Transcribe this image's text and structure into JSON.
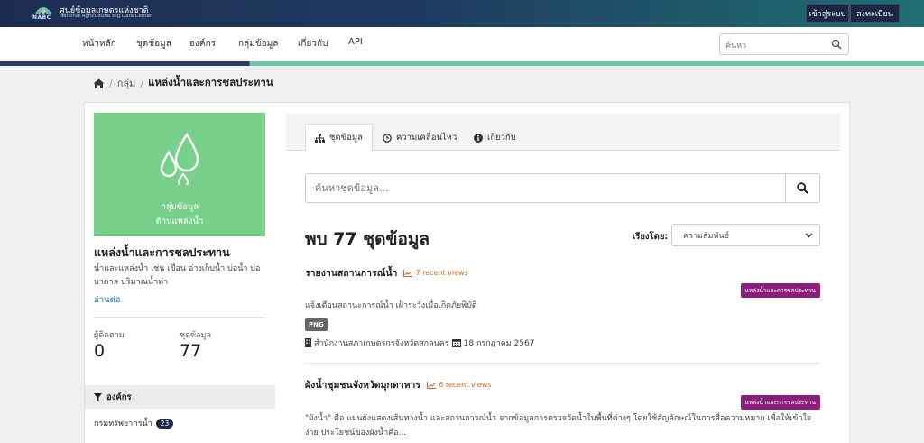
{
  "header": {
    "logo_text": "NABC",
    "site_title": "ศูนย์ข้อมูลเกษตรแห่งชาติ",
    "site_subtitle": "National Agricultural Big Data Center",
    "login_label": "เข้าสู่ระบบ",
    "register_label": "ลงทะเบียน"
  },
  "nav": {
    "items": [
      "หน้าหลัก",
      "ชุดข้อมูล",
      "องค์กร",
      "กลุ่มข้อมูล",
      "เกี่ยวกับ",
      "API"
    ],
    "search_placeholder": "ค้นหา"
  },
  "breadcrumb": {
    "home_icon": "home-icon",
    "level1": "กลุ่ม",
    "current": "แหล่งน้ำและการชลประทาน"
  },
  "sidebar": {
    "image_text_line1": "กลุ่มข้อมูล",
    "image_text_line2": "ด้านแหล่งน้ำ",
    "group_name": "แหล่งน้ำและการชลประทาน",
    "group_description": "น้ำและแหล่งน้ำ เช่น เขื่อน อ่างเก็บน้ำ บ่อน้ำ บ่อบาดาล ปริมาณน้ำท่า",
    "read_more": "อ่านต่อ",
    "followers_label": "ผู้ติดตาม",
    "followers_value": "0",
    "datasets_label": "ชุดข้อมูล",
    "datasets_value": "77",
    "org_header": "องค์กร",
    "orgs": [
      {
        "name": "กรมทรัพยากรน้ำ",
        "count": "23"
      }
    ]
  },
  "tabs": [
    {
      "label": "ชุดข้อมูล",
      "icon": "sitemap-icon"
    },
    {
      "label": "ความเคลื่อนไหว",
      "icon": "clock-icon"
    },
    {
      "label": "เกี่ยวกับ",
      "icon": "info-icon"
    }
  ],
  "search": {
    "placeholder": "ค้นหาชุดข้อมูล..."
  },
  "results": {
    "count_text": "พบ 77 ชุดข้อมูล",
    "sort_label": "เรียงโดย:",
    "sort_value": "ความสัมพันธ์"
  },
  "datasets": [
    {
      "title": "รายงานสถานการณ์น้ำ",
      "views": "7 recent views",
      "tag": "แหล่งน้ำและการชลประทาน",
      "description": "แจ้งเตือนสถานะการณ์น้ำ เฝ้าระวังเมื่อเกิดภัยพิบัติ",
      "format": "PNG",
      "org": "สำนักงานสภาเกษตรกรจังหวัดสกลนคร",
      "date": "18 กรกฎาคม 2567"
    },
    {
      "title": "ผังน้ำชุมชนจังหวัดมุกดาหาร",
      "views": "6 recent views",
      "tag": "แหล่งน้ำและการชลประทาน",
      "description": "\"ผังน้ำ\" คือ แผนผังแสดงเส้นทางน้ำ และสถานการณ์น้ำ จากข้อมูลการตรวจวัดน้ำในพื้นที่ต่างๆ โดยใช้สัญลักษณ์ในการสื่อความหมาย เพื่อให้เข้าใจง่าย ประโยชน์ของผังน้ำคือ..."
    }
  ],
  "colors": {
    "group_image_bg": "#78d08a",
    "tag_bg": "#8b1d7d",
    "views": "#e0651b",
    "brand_dark": "#1b2744"
  }
}
